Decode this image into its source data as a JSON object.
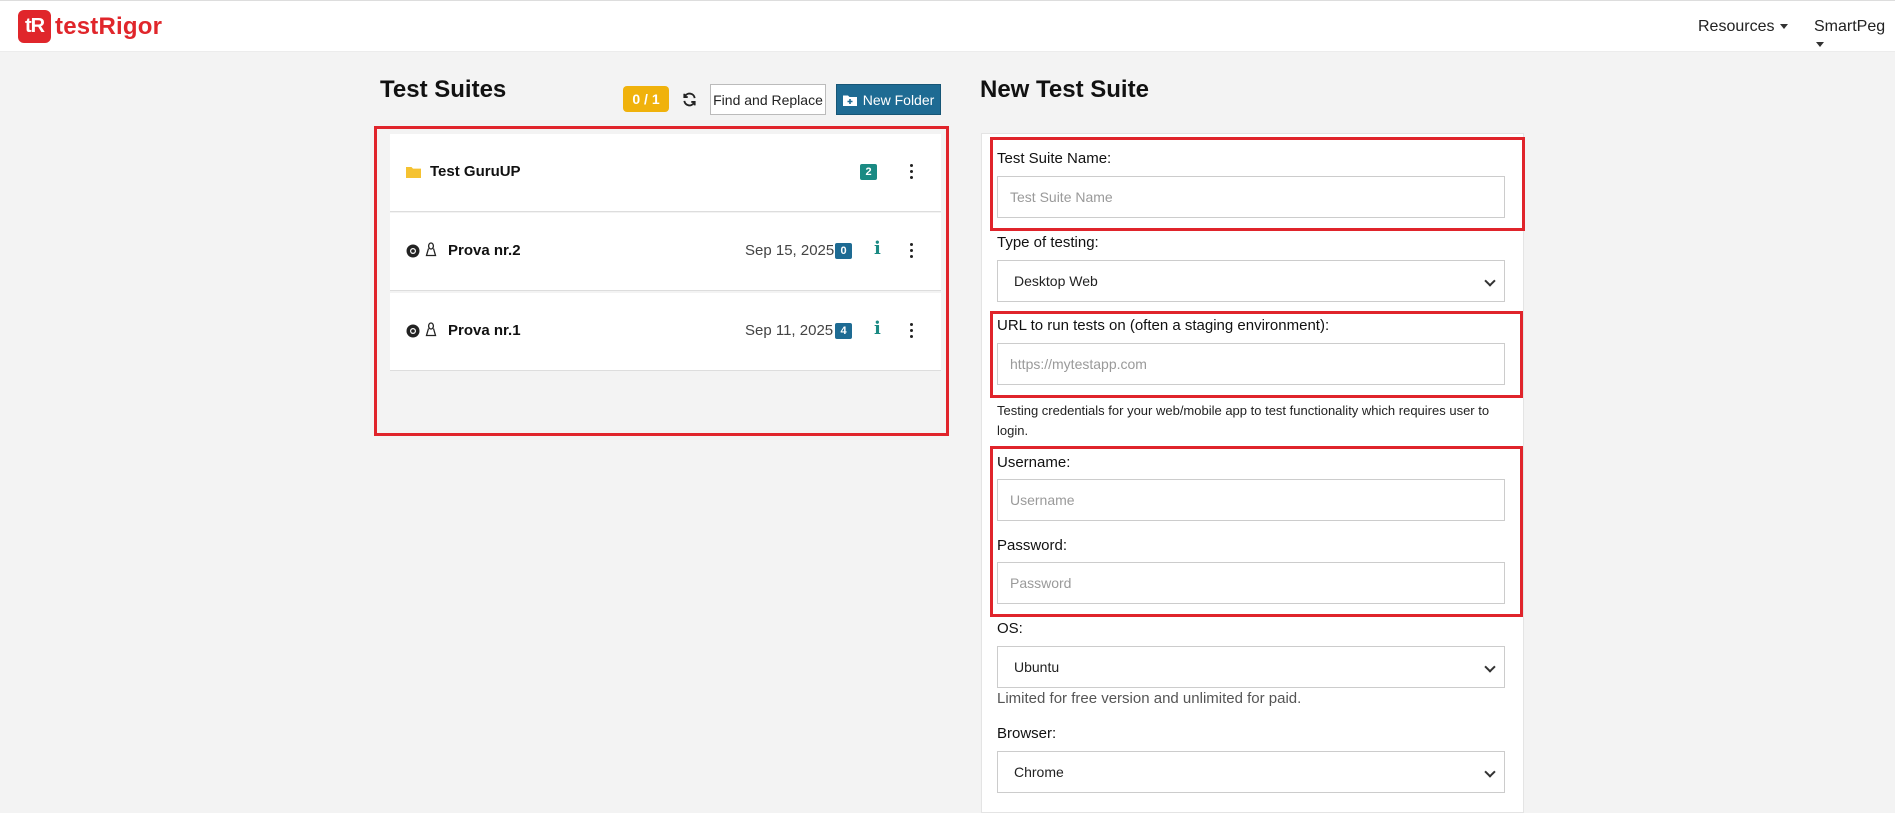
{
  "brand": {
    "mark": "tR",
    "name": "testRigor"
  },
  "nav": {
    "resources": "Resources",
    "account": "SmartPeg"
  },
  "suites": {
    "title": "Test Suites",
    "counter": "0 / 1",
    "find_replace": "Find and Replace",
    "new_folder": "New Folder",
    "items": [
      {
        "name": "Test GuruUP",
        "kind": "folder",
        "date": "",
        "count": "2"
      },
      {
        "name": "Prova nr.2",
        "kind": "suite",
        "date": "Sep 15, 2025",
        "count": "0",
        "info": "i"
      },
      {
        "name": "Prova nr.1",
        "kind": "suite",
        "date": "Sep 11, 2025",
        "count": "4",
        "info": "i"
      }
    ]
  },
  "form": {
    "title": "New Test Suite",
    "name_label": "Test Suite Name:",
    "name_placeholder": "Test Suite Name",
    "type_label": "Type of testing:",
    "type_value": "Desktop Web",
    "url_label": "URL to run tests on (often a staging environment):",
    "url_placeholder": "https://mytestapp.com",
    "credentials_help": "Testing credentials for your web/mobile app to test functionality which requires user to login.",
    "username_label": "Username:",
    "username_placeholder": "Username",
    "password_label": "Password:",
    "password_placeholder": "Password",
    "os_label": "OS:",
    "os_value": "Ubuntu",
    "os_note": "Limited for free version and unlimited for paid.",
    "browser_label": "Browser:",
    "browser_value": "Chrome"
  },
  "colors": {
    "brand_red": "#e0262b",
    "highlight_red": "#e0242b",
    "counter_yellow": "#f0b20c",
    "folder_badge": "#1a8a83",
    "suite_badge": "#1e6b93",
    "primary_blue": "#1e6b93"
  }
}
